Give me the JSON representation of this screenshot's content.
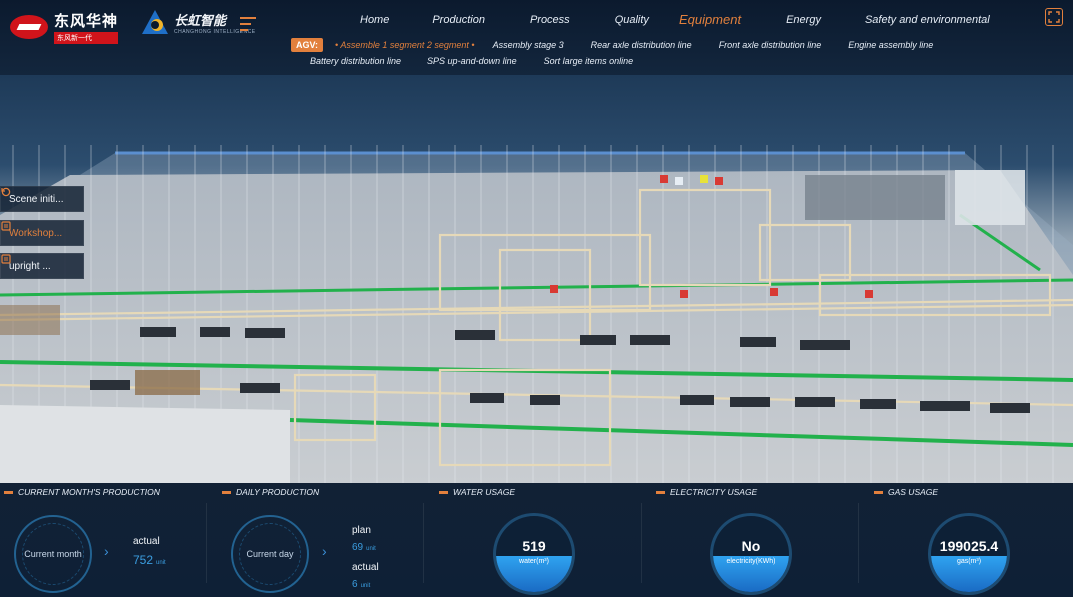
{
  "brand": {
    "name_cn": "东风华神",
    "slogan_cn": "东风新一代"
  },
  "partner": {
    "name_cn": "长虹智能",
    "name_en": "CHANGHONG INTELLIGENCE"
  },
  "nav": {
    "items": [
      "Home",
      "Production",
      "Process",
      "Quality",
      "Equipment",
      "Energy",
      "Safety and environmental"
    ],
    "active": "Equipment"
  },
  "sub_nav": {
    "tag": "AGV:",
    "row1": [
      "Assemble 1 segment 2 segment",
      "Assembly stage 3",
      "Rear axle distribution line",
      "Front axle distribution line",
      "Engine assembly line"
    ],
    "row2": [
      "Battery distribution line",
      "SPS up-and-down line",
      "Sort large items online"
    ],
    "active": "Assemble 1 segment 2 segment"
  },
  "tools": [
    {
      "label": "Scene initi...",
      "icon": "reset-icon"
    },
    {
      "label": "Workshop...",
      "icon": "layers-icon"
    },
    {
      "label": "upright ...",
      "icon": "layers-icon"
    }
  ],
  "kpis": {
    "month": {
      "title": "CURRENT MONTH'S PRODUCTION",
      "ring_label": "Current month",
      "actual_label": "actual",
      "actual_value": "752",
      "unit": "unit"
    },
    "day": {
      "title": "DAILY PRODUCTION",
      "ring_label": "Current day",
      "plan_label": "plan",
      "plan_value": "69",
      "actual_label": "actual",
      "actual_value": "6",
      "unit": "unit"
    },
    "water": {
      "title": "WATER USAGE",
      "value": "519",
      "unit": "water(m³)",
      "fill": 0.48
    },
    "electricity": {
      "title": "ELECTRICITY USAGE",
      "value": "No",
      "unit": "electricity(KWh)",
      "fill": 0.48
    },
    "gas": {
      "title": "GAS USAGE",
      "value": "199025.4",
      "unit": "gas(m³)",
      "fill": 0.48
    }
  },
  "colors": {
    "accent": "#e2803d",
    "blue": "#3b9de0",
    "panel": "#0e2036",
    "track": "#22b14c"
  }
}
